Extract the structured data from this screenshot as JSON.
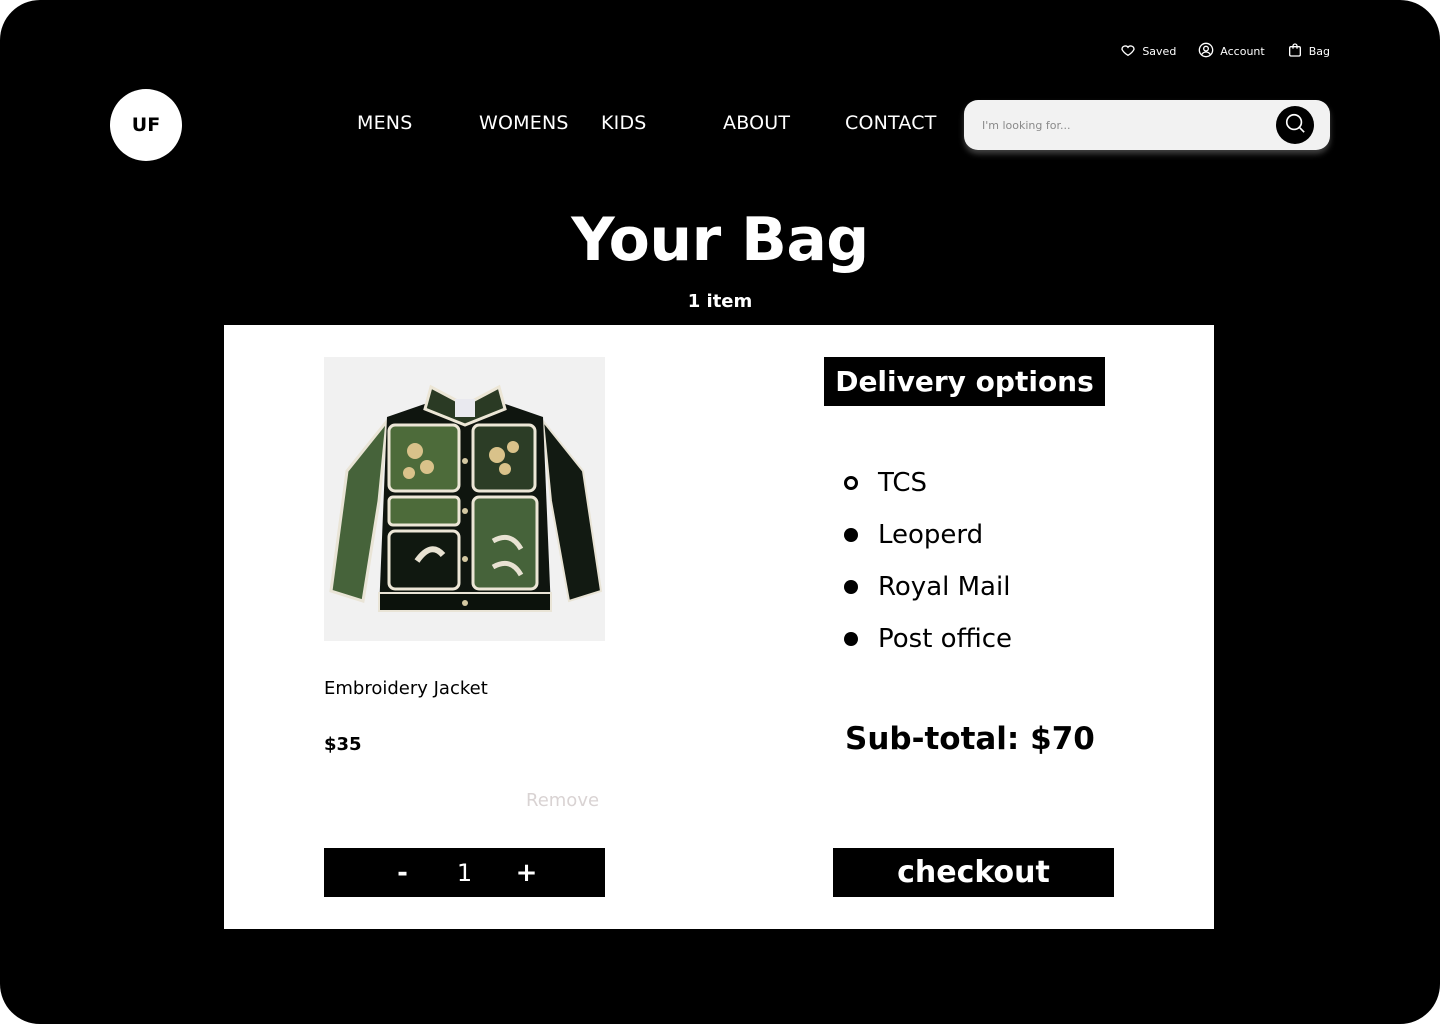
{
  "utility": {
    "saved": "Saved",
    "account": "Account",
    "bag": "Bag"
  },
  "logo": "UF",
  "nav": {
    "mens": "MENS",
    "womens": "WOMENS",
    "kids": "KIDS",
    "about": "ABOUT",
    "contact": "CONTACT"
  },
  "search": {
    "placeholder": "I'm looking for..."
  },
  "page": {
    "title": "Your Bag",
    "item_count": "1 item"
  },
  "product": {
    "name": "Embroidery Jacket",
    "price": "$35",
    "remove_label": "Remove",
    "quantity": "1",
    "minus_label": "-",
    "plus_label": "+"
  },
  "delivery": {
    "heading": "Delivery options",
    "options": [
      {
        "label": "TCS",
        "selected": true
      },
      {
        "label": "Leoperd",
        "selected": false
      },
      {
        "label": "Royal Mail",
        "selected": false
      },
      {
        "label": "Post office",
        "selected": false
      }
    ]
  },
  "summary": {
    "subtotal": "Sub-total: $70",
    "checkout_label": "checkout"
  },
  "colors": {
    "background": "#000000",
    "card": "#ffffff",
    "jacket_green": "#4d6b3a"
  }
}
